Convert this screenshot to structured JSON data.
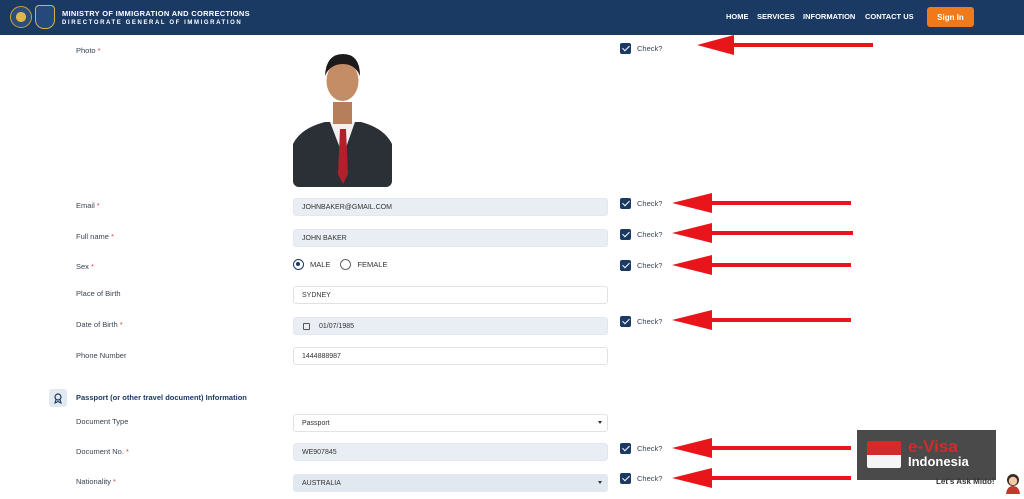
{
  "header": {
    "title_line1": "MINISTRY OF IMMIGRATION AND CORRECTIONS",
    "title_line2": "DIRECTORATE GENERAL OF IMMIGRATION",
    "nav": [
      "HOME",
      "SERVICES",
      "INFORMATION",
      "CONTACT US"
    ],
    "signin": "Sign In",
    "colors": {
      "bar": "#1b3a63",
      "accent": "#f07a1a"
    }
  },
  "form": {
    "photo_label": "Photo",
    "email": {
      "label": "Email",
      "value": "JOHNBAKER@GMAIL.COM"
    },
    "full_name": {
      "label": "Full name",
      "value": "JOHN BAKER"
    },
    "sex": {
      "label": "Sex",
      "options": [
        "MALE",
        "FEMALE"
      ],
      "selected": "MALE"
    },
    "place_of_birth": {
      "label": "Place of Birth",
      "value": "SYDNEY"
    },
    "date_of_birth": {
      "label": "Date of Birth",
      "value": "01/07/1985"
    },
    "phone": {
      "label": "Phone Number",
      "value": "1444888987"
    },
    "section_title": "Passport (or other travel document) Information",
    "document_type": {
      "label": "Document Type",
      "value": "Passport"
    },
    "document_no": {
      "label": "Document No.",
      "value": "WE907845"
    },
    "nationality": {
      "label": "Nationality",
      "value": "AUSTRALIA"
    },
    "required_mark": "*",
    "check_label": "Check?"
  },
  "overlay": {
    "evisa_line1": "e-Visa",
    "evisa_line2": "Indonesia",
    "chat": "Let's Ask Mido!",
    "arrow_color": "#e8161b"
  }
}
